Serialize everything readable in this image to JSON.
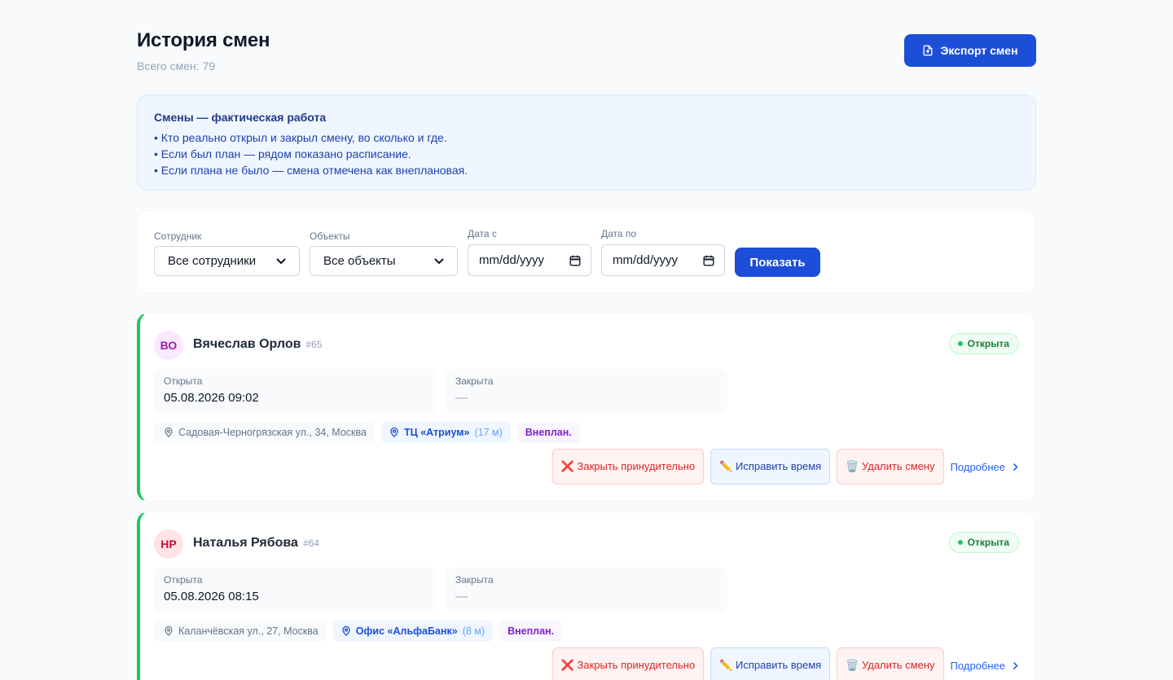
{
  "header": {
    "title": "История смен",
    "subtitle_label": "Всего смен:",
    "total_count": "79",
    "export_label": "Экспорт смен"
  },
  "info": {
    "title": "Смены — фактическая работа",
    "lines": [
      "• Кто реально открыл и закрыл смену, во сколько и где.",
      "• Если был план — рядом показано расписание.",
      "• Если плана не было — смена отмечена как внеплановая."
    ]
  },
  "filters": {
    "employee_label": "Сотрудник",
    "employee_value": "Все сотрудники",
    "objects_label": "Объекты",
    "objects_value": "Все объекты",
    "date_from_label": "Дата с",
    "date_from_value": "mm/dd/yyyy",
    "date_to_label": "Дата по",
    "date_to_value": "mm/dd/yyyy",
    "show_label": "Показать"
  },
  "labels": {
    "opened": "Открыта",
    "closed": "Закрыта",
    "force_close": "❌ Закрыть принудительно",
    "fix_time": "✏️ Исправить время",
    "delete": "🗑️ Удалить смену",
    "more": "Подробнее"
  },
  "shifts": [
    {
      "initials": "ВО",
      "name": "Вячеслав Орлов",
      "id": "#65",
      "status": "Открыта",
      "opened_at": "05.08.2026 09:02",
      "closed_at": "—",
      "address": "Садовая-Черногрязская ул., 34, Москва",
      "object": "ТЦ «Атриум»",
      "distance": "(17 м)",
      "tag": "Внеплан.",
      "avatar_bg": "#fae8ff",
      "avatar_fg": "#a21caf"
    },
    {
      "initials": "НР",
      "name": "Наталья Рябова",
      "id": "#64",
      "status": "Открыта",
      "opened_at": "05.08.2026 08:15",
      "closed_at": "—",
      "address": "Каланчёвская ул., 27, Москва",
      "object": "Офис «АльфаБанк»",
      "distance": "(8 м)",
      "tag": "Внеплан.",
      "avatar_bg": "#ffe4e6",
      "avatar_fg": "#be123c"
    }
  ],
  "colors": {
    "accent": "#1d4ed8",
    "status_open": "#22c55e"
  }
}
